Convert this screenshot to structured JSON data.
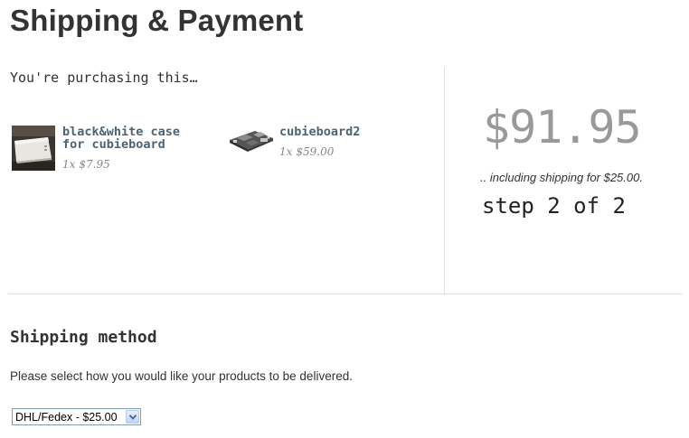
{
  "page": {
    "title": "Shipping & Payment"
  },
  "cart": {
    "heading": "You're purchasing this…",
    "items": [
      {
        "name_line1": "black&white case",
        "name_line2": "for cubieboard",
        "quantity": "1x",
        "price": "$7.95",
        "image_icon": "white-case-photo"
      },
      {
        "name_line1": "cubieboard2",
        "name_line2": "",
        "quantity": "1x",
        "price": "$59.00",
        "image_icon": "circuit-board-photo"
      }
    ]
  },
  "summary": {
    "total": "$91.95",
    "shipping_note": ".. including shipping for $25.00.",
    "step": "step 2 of 2"
  },
  "shipping": {
    "heading": "Shipping method",
    "instructions": "Please select how you would like your products to be delivered.",
    "selected_option": "DHL/Fedex - $25.00"
  },
  "colors": {
    "product_link": "#4a6476",
    "total_price": "#999999",
    "divider": "#e2e2e2"
  }
}
